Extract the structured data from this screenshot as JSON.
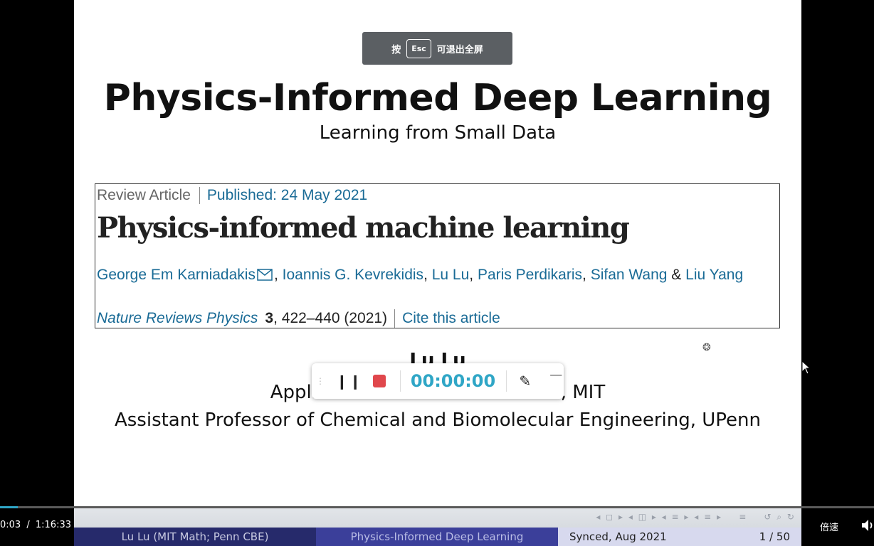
{
  "toast": {
    "prefix": "按",
    "key": "Esc",
    "suffix": "可退出全屏"
  },
  "slide": {
    "title": "Physics-Informed Deep Learning",
    "subtitle": "Learning from Small Data",
    "article": {
      "type": "Review Article",
      "published": "Published: 24 May 2021",
      "title": "Physics-informed machine learning",
      "authors": [
        "George Em Karniadakis",
        "Ioannis G. Kevrekidis",
        "Lu Lu",
        "Paris Perdikaris",
        "Sifan Wang",
        "Liu Yang"
      ],
      "journal": "Nature Reviews Physics",
      "volume": "3",
      "pages": ", 422–440 (2021)",
      "cite": "Cite this article"
    },
    "presenter_name": "Lu Lu",
    "presenter_line1": "Applied Mathematics Instructor, MIT",
    "presenter_line2": "Assistant Professor of Chemical and Biomolecular Engineering, UPenn"
  },
  "recorder": {
    "timer": "00:00:00"
  },
  "footer": {
    "left": "Lu Lu  (MIT Math; Penn CBE)",
    "center": "Physics-Informed Deep Learning",
    "date": "Synced, Aug 2021",
    "page": "1 / 50"
  },
  "player": {
    "current_time": "0:03",
    "separator": "/",
    "total_time": "1:16:33",
    "progress": 0.001,
    "speed_label": "倍速"
  },
  "icons": {
    "mail": "envelope-icon",
    "pause": "pause-icon",
    "stop": "stop-icon",
    "pen": "pen-icon",
    "minimize": "minimize-icon",
    "volume": "volume-icon"
  },
  "colors": {
    "link": "#1a6b96",
    "timer": "#2fa6c6",
    "stop": "#e0474c",
    "footer_dark": "#262a6b",
    "footer_mid": "#3b3f9a",
    "footer_light": "#d7d9ee"
  }
}
